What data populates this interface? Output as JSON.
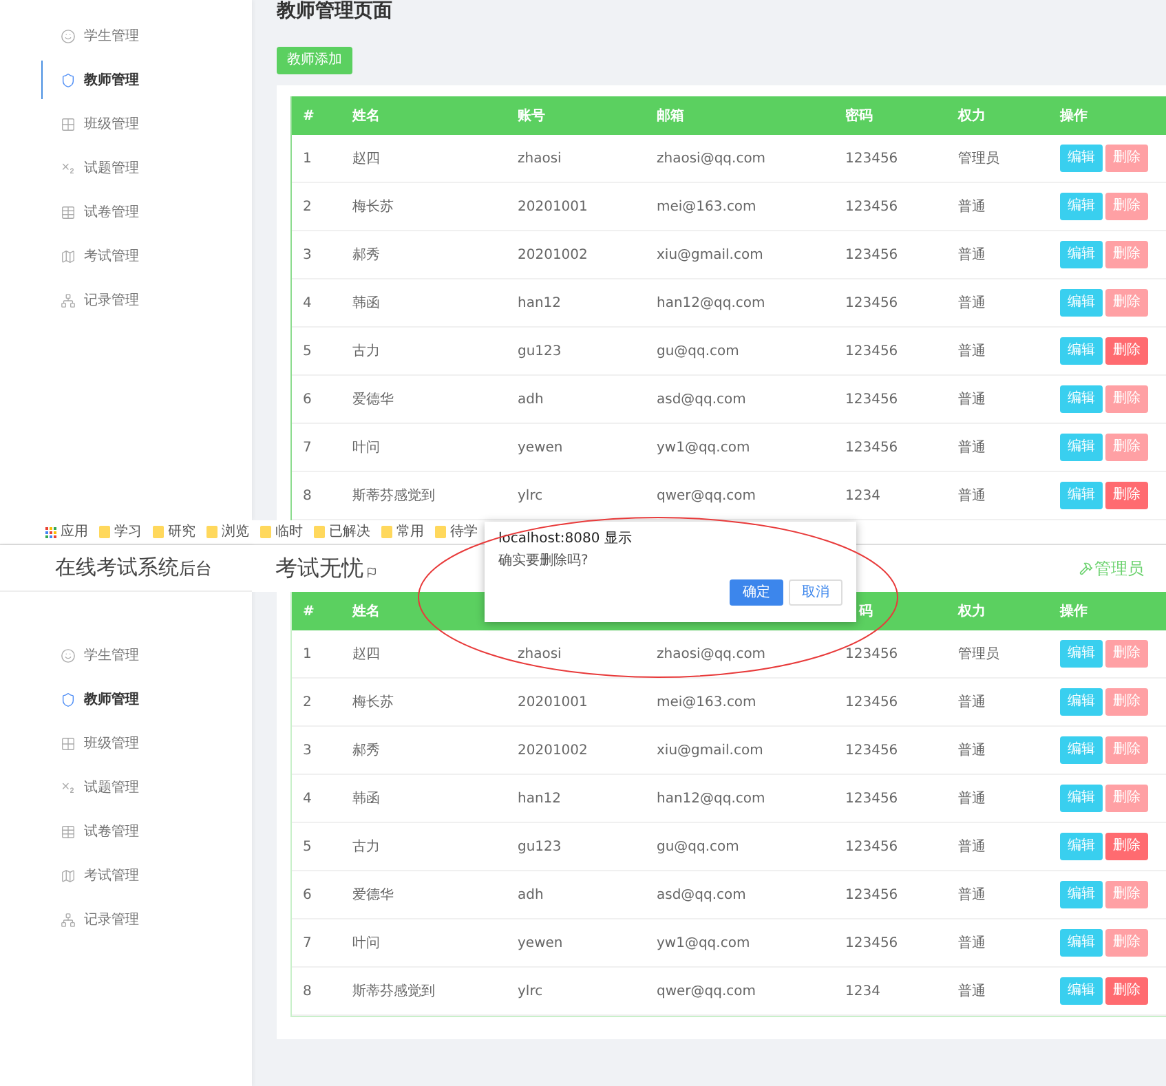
{
  "top": {
    "sidebar": {
      "items": [
        {
          "label": "学生管理",
          "selected": false
        },
        {
          "label": "教师管理",
          "selected": true
        },
        {
          "label": "班级管理",
          "selected": false
        },
        {
          "label": "试题管理",
          "selected": false
        },
        {
          "label": "试卷管理",
          "selected": false
        },
        {
          "label": "考试管理",
          "selected": false
        },
        {
          "label": "记录管理",
          "selected": false
        }
      ]
    },
    "page_title": "教师管理页面",
    "add_button": "教师添加",
    "table": {
      "columns": [
        "#",
        "姓名",
        "账号",
        "邮箱",
        "密码",
        "权力",
        "操作"
      ],
      "rows": [
        {
          "cells": [
            "1",
            "赵四",
            "zhaosi",
            "zhaosi@qq.com",
            "123456",
            "管理员"
          ],
          "edit": "编辑",
          "delete": "删除",
          "delete_active": false
        },
        {
          "cells": [
            "2",
            "梅长苏",
            "20201001",
            "mei@163.com",
            "123456",
            "普通"
          ],
          "edit": "编辑",
          "delete": "删除",
          "delete_active": false
        },
        {
          "cells": [
            "3",
            "郝秀",
            "20201002",
            "xiu@gmail.com",
            "123456",
            "普通"
          ],
          "edit": "编辑",
          "delete": "删除",
          "delete_active": false
        },
        {
          "cells": [
            "4",
            "韩函",
            "han12",
            "han12@qq.com",
            "123456",
            "普通"
          ],
          "edit": "编辑",
          "delete": "删除",
          "delete_active": false
        },
        {
          "cells": [
            "5",
            "古力",
            "gu123",
            "gu@qq.com",
            "123456",
            "普通"
          ],
          "edit": "编辑",
          "delete": "删除",
          "delete_active": true
        },
        {
          "cells": [
            "6",
            "爱德华",
            "adh",
            "asd@qq.com",
            "123456",
            "普通"
          ],
          "edit": "编辑",
          "delete": "删除",
          "delete_active": false
        },
        {
          "cells": [
            "7",
            "叶问",
            "yewen",
            "yw1@qq.com",
            "123456",
            "普通"
          ],
          "edit": "编辑",
          "delete": "删除",
          "delete_active": false
        },
        {
          "cells": [
            "8",
            "斯蒂芬感觉到",
            "ylrc",
            "qwer@qq.com",
            "1234",
            "普通"
          ],
          "edit": "编辑",
          "delete": "删除",
          "delete_active": true
        }
      ]
    }
  },
  "bottom": {
    "bookmarks": [
      {
        "label": "应用",
        "kind": "apps"
      },
      {
        "label": "学习",
        "kind": "folder"
      },
      {
        "label": "研究",
        "kind": "folder"
      },
      {
        "label": "浏览",
        "kind": "folder"
      },
      {
        "label": "临时",
        "kind": "folder"
      },
      {
        "label": "已解决",
        "kind": "folder"
      },
      {
        "label": "常用",
        "kind": "folder"
      },
      {
        "label": "待学",
        "kind": "folder"
      }
    ],
    "brand": {
      "title": "在线考试系统",
      "suffix": "后台"
    },
    "header_title": "考试无忧",
    "user": "管理员",
    "sidebar": {
      "items": [
        {
          "label": "学生管理",
          "selected": false
        },
        {
          "label": "教师管理",
          "selected": true
        },
        {
          "label": "班级管理",
          "selected": false
        },
        {
          "label": "试题管理",
          "selected": false
        },
        {
          "label": "试卷管理",
          "selected": false
        },
        {
          "label": "考试管理",
          "selected": false
        },
        {
          "label": "记录管理",
          "selected": false
        }
      ]
    },
    "table": {
      "columns": [
        "#",
        "姓名",
        "",
        "",
        "码",
        "权力",
        "操作"
      ],
      "rows": [
        {
          "cells": [
            "1",
            "赵四",
            "zhaosi",
            "zhaosi@qq.com",
            "123456",
            "管理员"
          ],
          "edit": "编辑",
          "delete": "删除",
          "delete_active": false
        },
        {
          "cells": [
            "2",
            "梅长苏",
            "20201001",
            "mei@163.com",
            "123456",
            "普通"
          ],
          "edit": "编辑",
          "delete": "删除",
          "delete_active": false
        },
        {
          "cells": [
            "3",
            "郝秀",
            "20201002",
            "xiu@gmail.com",
            "123456",
            "普通"
          ],
          "edit": "编辑",
          "delete": "删除",
          "delete_active": false
        },
        {
          "cells": [
            "4",
            "韩函",
            "han12",
            "han12@qq.com",
            "123456",
            "普通"
          ],
          "edit": "编辑",
          "delete": "删除",
          "delete_active": false
        },
        {
          "cells": [
            "5",
            "古力",
            "gu123",
            "gu@qq.com",
            "123456",
            "普通"
          ],
          "edit": "编辑",
          "delete": "删除",
          "delete_active": true
        },
        {
          "cells": [
            "6",
            "爱德华",
            "adh",
            "asd@qq.com",
            "123456",
            "普通"
          ],
          "edit": "编辑",
          "delete": "删除",
          "delete_active": false
        },
        {
          "cells": [
            "7",
            "叶问",
            "yewen",
            "yw1@qq.com",
            "123456",
            "普通"
          ],
          "edit": "编辑",
          "delete": "删除",
          "delete_active": false
        },
        {
          "cells": [
            "8",
            "斯蒂芬感觉到",
            "ylrc",
            "qwer@qq.com",
            "1234",
            "普通"
          ],
          "edit": "编辑",
          "delete": "删除",
          "delete_active": true
        }
      ]
    }
  },
  "dialog": {
    "origin": "localhost:8080 显示",
    "message": "确实要删除吗?",
    "buttons": [
      {
        "label": "确定",
        "kind": "primary"
      },
      {
        "label": "取消",
        "kind": "secondary"
      }
    ]
  }
}
